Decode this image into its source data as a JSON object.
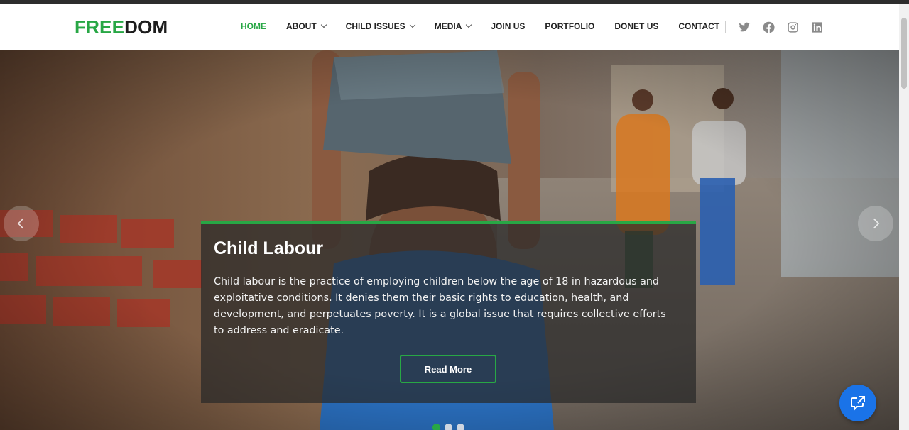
{
  "brand": {
    "part1": "FREE",
    "part2": "DOM"
  },
  "nav": [
    {
      "label": "HOME",
      "active": true,
      "dropdown": false
    },
    {
      "label": "ABOUT",
      "active": false,
      "dropdown": true
    },
    {
      "label": "CHILD ISSUES",
      "active": false,
      "dropdown": true
    },
    {
      "label": "MEDIA",
      "active": false,
      "dropdown": true
    },
    {
      "label": "JOIN US",
      "active": false,
      "dropdown": false
    },
    {
      "label": "PORTFOLIO",
      "active": false,
      "dropdown": false
    },
    {
      "label": "DONET US",
      "active": false,
      "dropdown": false
    },
    {
      "label": "CONTACT",
      "active": false,
      "dropdown": false
    }
  ],
  "social_icons": [
    "twitter-icon",
    "facebook-icon",
    "instagram-icon",
    "linkedin-icon"
  ],
  "slide": {
    "title": "Child Labour",
    "text": "Child labour is the practice of employing children below the age of 18 in hazardous and exploitative conditions. It denies them their basic rights to education, health, and development, and perpetuates poverty. It is a global issue that requires collective efforts to address and eradicate.",
    "button": "Read More"
  },
  "carousel": {
    "slides": 3,
    "active": 1
  },
  "colors": {
    "accent": "#28a745",
    "chat": "#1a73e8"
  }
}
